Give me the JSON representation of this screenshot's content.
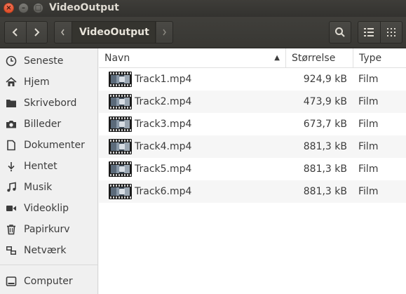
{
  "window": {
    "title": "VideoOutput"
  },
  "window_buttons": {
    "close": "×",
    "minimize": "–",
    "maximize": "□"
  },
  "pathbar": {
    "current": "VideoOutput"
  },
  "sidebar": {
    "places": [
      {
        "label": "Seneste",
        "icon": "clock-icon"
      },
      {
        "label": "Hjem",
        "icon": "home-icon"
      },
      {
        "label": "Skrivebord",
        "icon": "folder-icon"
      },
      {
        "label": "Billeder",
        "icon": "camera-icon"
      },
      {
        "label": "Dokumenter",
        "icon": "document-icon"
      },
      {
        "label": "Hentet",
        "icon": "download-icon"
      },
      {
        "label": "Musik",
        "icon": "music-icon"
      },
      {
        "label": "Videoklip",
        "icon": "video-icon"
      },
      {
        "label": "Papirkurv",
        "icon": "trash-icon"
      },
      {
        "label": "Netværk",
        "icon": "network-icon"
      }
    ],
    "devices": [
      {
        "label": "Computer",
        "icon": "drive-icon"
      }
    ]
  },
  "columns": {
    "name": "Navn",
    "size": "Størrelse",
    "type": "Type"
  },
  "files": [
    {
      "name": "Track1.mp4",
      "size": "924,9 kB",
      "type": "Film"
    },
    {
      "name": "Track2.mp4",
      "size": "473,9 kB",
      "type": "Film"
    },
    {
      "name": "Track3.mp4",
      "size": "673,7 kB",
      "type": "Film"
    },
    {
      "name": "Track4.mp4",
      "size": "881,3 kB",
      "type": "Film"
    },
    {
      "name": "Track5.mp4",
      "size": "881,3 kB",
      "type": "Film"
    },
    {
      "name": "Track6.mp4",
      "size": "881,3 kB",
      "type": "Film"
    }
  ]
}
